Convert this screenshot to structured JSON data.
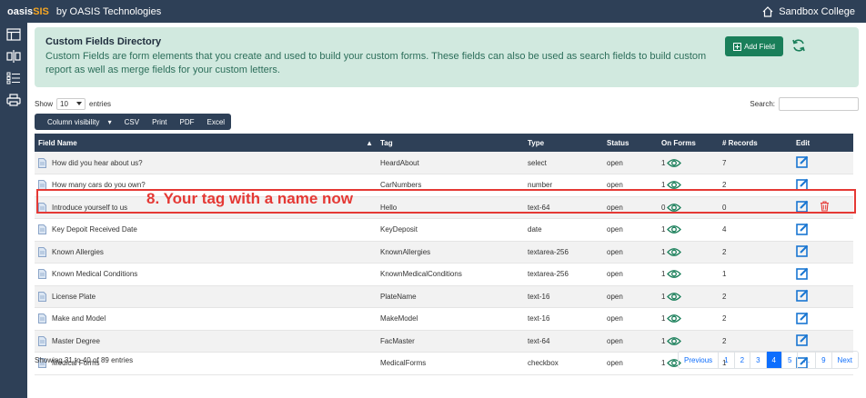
{
  "app": {
    "brand_main": "oasis",
    "brand_accent": "SIS",
    "by_line": "by OASIS Technologies",
    "college": "Sandbox College"
  },
  "banner": {
    "title": "Custom Fields Directory",
    "description": "Custom Fields are form elements that you create and used to build your custom forms. These fields can also be used as search fields to build custom report as well as merge fields for your custom letters.",
    "add_button": "Add Field"
  },
  "controls": {
    "show_label": "Show",
    "entries_value": "10",
    "entries_label": "entries",
    "search_label": "Search:",
    "search_value": ""
  },
  "buttons": [
    "Column visibility",
    "CSV",
    "Print",
    "PDF",
    "Excel"
  ],
  "table": {
    "headers": [
      "Field Name",
      "Tag",
      "Type",
      "Status",
      "On Forms",
      "# Records",
      "Edit"
    ],
    "rows": [
      {
        "name": "How did you hear about us?",
        "tag": "HeardAbout",
        "type": "select",
        "status": "open",
        "forms": "1",
        "records": "7"
      },
      {
        "name": "How many cars do you own?",
        "tag": "CarNumbers",
        "type": "number",
        "status": "open",
        "forms": "1",
        "records": "2"
      },
      {
        "name": "Introduce yourself to us",
        "tag": "Hello",
        "type": "text-64",
        "status": "open",
        "forms": "0",
        "records": "0"
      },
      {
        "name": "Key Depoit Received Date",
        "tag": "KeyDeposit",
        "type": "date",
        "status": "open",
        "forms": "1",
        "records": "4"
      },
      {
        "name": "Known Allergies",
        "tag": "KnownAllergies",
        "type": "textarea-256",
        "status": "open",
        "forms": "1",
        "records": "2"
      },
      {
        "name": "Known Medical Conditions",
        "tag": "KnownMedicalConditions",
        "type": "textarea-256",
        "status": "open",
        "forms": "1",
        "records": "1"
      },
      {
        "name": "License Plate",
        "tag": "PlateName",
        "type": "text-16",
        "status": "open",
        "forms": "1",
        "records": "2"
      },
      {
        "name": "Make and Model",
        "tag": "MakeModel",
        "type": "text-16",
        "status": "open",
        "forms": "1",
        "records": "2"
      },
      {
        "name": "Master Degree",
        "tag": "FacMaster",
        "type": "text-64",
        "status": "open",
        "forms": "1",
        "records": "2"
      },
      {
        "name": "Medical Forms",
        "tag": "MedicalForms",
        "type": "checkbox",
        "status": "open",
        "forms": "1",
        "records": "1"
      }
    ]
  },
  "annotation": "8. Your tag with a name now",
  "footer": {
    "info": "Showing 31 to 40 of 89 entries",
    "pages": [
      "Previous",
      "1",
      "2",
      "3",
      "4",
      "5",
      "...",
      "9",
      "Next"
    ],
    "active_page": "4"
  },
  "colors": {
    "navy": "#2e4057",
    "banner_bg": "#d1e9df",
    "add_button": "#1a7f5a",
    "edit_icon": "#1976d2",
    "delete_icon": "#e53935",
    "eye_icon": "#1a7f5a",
    "pager_active": "#0d6efd"
  }
}
